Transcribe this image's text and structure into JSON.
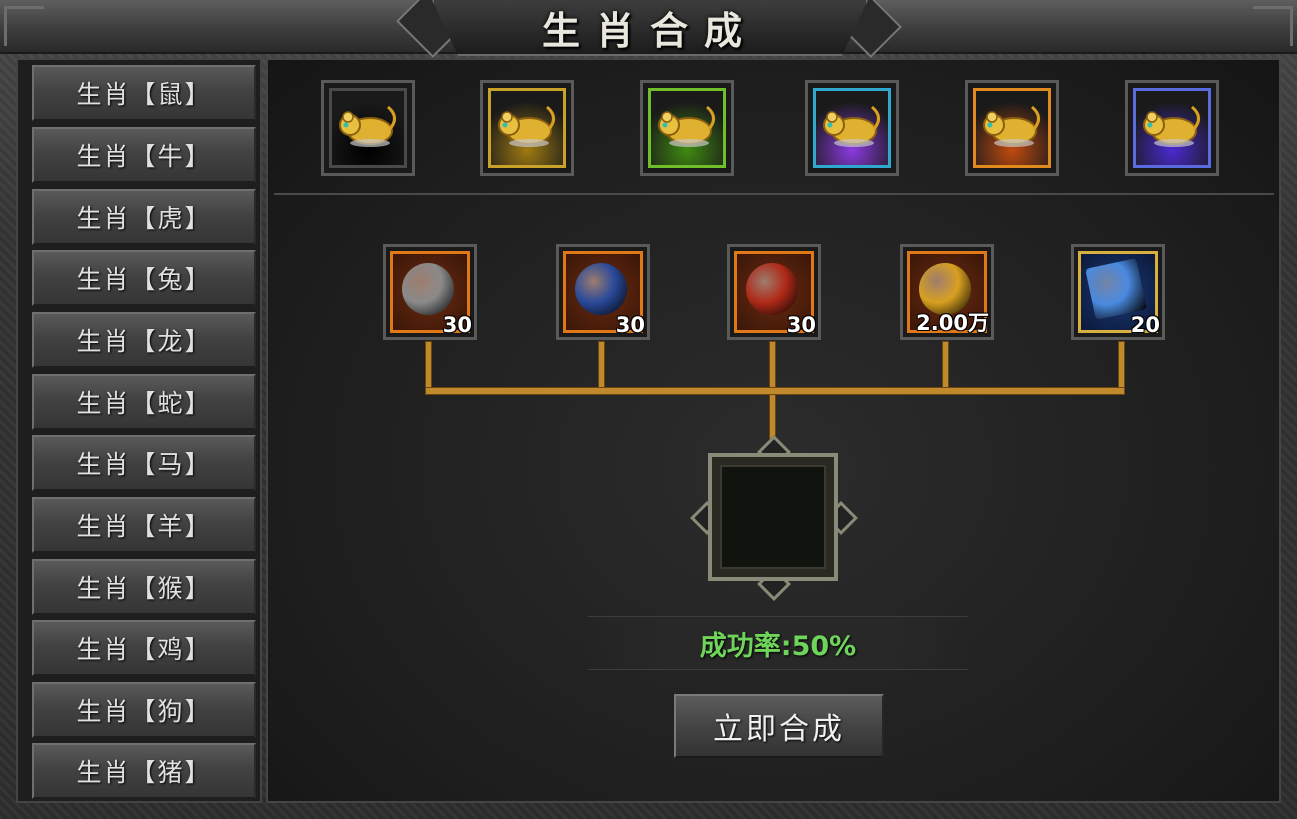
{
  "window": {
    "title": "生肖合成"
  },
  "sidebar": {
    "items": [
      {
        "label": "生肖【鼠】"
      },
      {
        "label": "生肖【牛】"
      },
      {
        "label": "生肖【虎】"
      },
      {
        "label": "生肖【兔】"
      },
      {
        "label": "生肖【龙】"
      },
      {
        "label": "生肖【蛇】"
      },
      {
        "label": "生肖【马】"
      },
      {
        "label": "生肖【羊】"
      },
      {
        "label": "生肖【猴】"
      },
      {
        "label": "生肖【鸡】"
      },
      {
        "label": "生肖【狗】"
      },
      {
        "label": "生肖【猪】"
      }
    ]
  },
  "tiers": [
    {
      "icon": "golden-rat-icon",
      "frame_color": "#4a4a4a",
      "glow_color": "#000000"
    },
    {
      "icon": "golden-rat-icon",
      "frame_color": "#c9a22a",
      "glow_color": "#a07a10"
    },
    {
      "icon": "golden-rat-icon",
      "frame_color": "#6fbe2a",
      "glow_color": "#3f8a10"
    },
    {
      "icon": "golden-rat-icon",
      "frame_color": "#2fa8d0",
      "glow_color": "#8a3adf"
    },
    {
      "icon": "golden-rat-icon",
      "frame_color": "#e08a20",
      "glow_color": "#c04a10"
    },
    {
      "icon": "golden-rat-icon",
      "frame_color": "#5a6adf",
      "glow_color": "#4a2ad0"
    }
  ],
  "materials": [
    {
      "icon": "seal-token-icon",
      "qty": "30",
      "orb_color": "#8a8a8a"
    },
    {
      "icon": "blue-orb-icon",
      "qty": "30",
      "orb_color": "#2a4a9a"
    },
    {
      "icon": "red-orb-icon",
      "qty": "30",
      "orb_color": "#b02a18"
    },
    {
      "icon": "gold-coins-icon",
      "qty": "2.00万",
      "orb_color": "#d8a020"
    },
    {
      "icon": "sky-crystal-icon",
      "qty": "20",
      "orb_color": "#4a8ae0"
    }
  ],
  "result": {
    "success_rate": "成功率:50%"
  },
  "actions": {
    "compose_label": "立即合成"
  }
}
